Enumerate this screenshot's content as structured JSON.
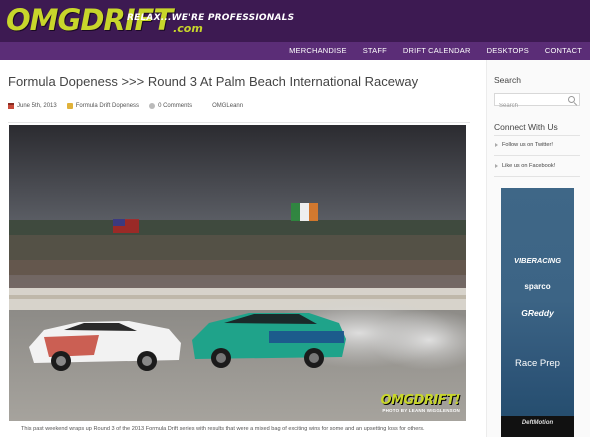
{
  "site": {
    "logo": "OMGDRIFT",
    "logo_suffix": ".com",
    "tagline": "RELAX...WE'RE PROFESSIONALS"
  },
  "nav": {
    "items": [
      "MERCHANDISE",
      "STAFF",
      "DRIFT CALENDAR",
      "DESKTOPS",
      "CONTACT"
    ]
  },
  "post": {
    "title": "Formula Dopeness >>> Round 3 At Palm Beach International Raceway",
    "date": "June 5th, 2013",
    "category": "Formula Drift Dopeness",
    "comments": "0 Comments",
    "author": "OMGLeann",
    "excerpt": "This past weekend wraps up Round 3 of the 2013 Formula Drift series with results that were a mixed bag of exciting wins for some and an upsetting loss for others.",
    "photo": {
      "watermark": "OMGDRIFT!",
      "credit": "PHOTO BY LEANN WIGGLENSON"
    }
  },
  "sidebar": {
    "search_heading": "Search",
    "search_placeholder": "Search",
    "connect_heading": "Connect With Us",
    "links": [
      "Follow us on Twitter!",
      "Like us on Facebook!"
    ]
  },
  "ad": {
    "brands": [
      "VIBERACING",
      "sparco",
      "GReddy"
    ],
    "headline": "Race Prep",
    "footer_brand": "DeftMotion"
  },
  "colors": {
    "header_bg": "#3d1a52",
    "nav_bg": "#5b2d77",
    "logo_accent": "#c8d62b"
  }
}
